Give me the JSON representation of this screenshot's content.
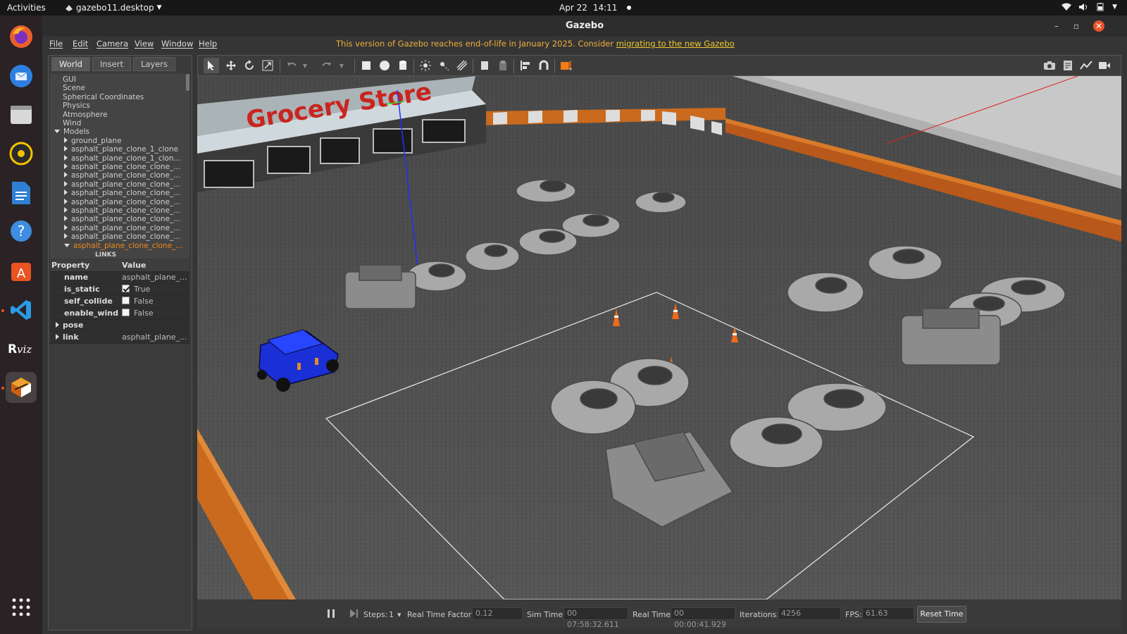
{
  "topbar": {
    "activities": "Activities",
    "app_name": "gazebo11.desktop",
    "date": "Apr 22",
    "time": "14:11"
  },
  "window": {
    "title": "Gazebo",
    "menu": [
      "File",
      "Edit",
      "Camera",
      "View",
      "Window",
      "Help"
    ],
    "eol_text": "This version of Gazebo reaches end-of-life in January 2025. Consider ",
    "eol_link": "migrating to the new Gazebo"
  },
  "left_panel": {
    "tabs": [
      "World",
      "Insert",
      "Layers"
    ],
    "tree": [
      {
        "label": "GUI",
        "indent": 0,
        "arrow": "none"
      },
      {
        "label": "Scene",
        "indent": 0,
        "arrow": "none"
      },
      {
        "label": "Spherical Coordinates",
        "indent": 0,
        "arrow": "none"
      },
      {
        "label": "Physics",
        "indent": 0,
        "arrow": "none"
      },
      {
        "label": "Atmosphere",
        "indent": 0,
        "arrow": "none"
      },
      {
        "label": "Wind",
        "indent": 0,
        "arrow": "none"
      },
      {
        "label": "Models",
        "indent": 0,
        "arrow": "down"
      },
      {
        "label": "ground_plane",
        "indent": 1,
        "arrow": "right"
      },
      {
        "label": "asphalt_plane_clone_1_clone",
        "indent": 1,
        "arrow": "right"
      },
      {
        "label": "asphalt_plane_clone_1_clon...",
        "indent": 1,
        "arrow": "right"
      },
      {
        "label": "asphalt_plane_clone_clone_...",
        "indent": 1,
        "arrow": "right"
      },
      {
        "label": "asphalt_plane_clone_clone_...",
        "indent": 1,
        "arrow": "right"
      },
      {
        "label": "asphalt_plane_clone_clone_...",
        "indent": 1,
        "arrow": "right"
      },
      {
        "label": "asphalt_plane_clone_clone_...",
        "indent": 1,
        "arrow": "right"
      },
      {
        "label": "asphalt_plane_clone_clone_...",
        "indent": 1,
        "arrow": "right"
      },
      {
        "label": "asphalt_plane_clone_clone_...",
        "indent": 1,
        "arrow": "right"
      },
      {
        "label": "asphalt_plane_clone_clone_...",
        "indent": 1,
        "arrow": "right"
      },
      {
        "label": "asphalt_plane_clone_clone_...",
        "indent": 1,
        "arrow": "right"
      },
      {
        "label": "asphalt_plane_clone_clone_...",
        "indent": 1,
        "arrow": "right"
      },
      {
        "label": "asphalt_plane_clone_clone_...",
        "indent": 1,
        "arrow": "down",
        "selected": true
      },
      {
        "label": "LINKS",
        "indent": 2,
        "arrow": "none"
      }
    ],
    "properties": {
      "header": {
        "property": "Property",
        "value": "Value"
      },
      "name": {
        "key": "name",
        "value": "asphalt_plane_..."
      },
      "is_static": {
        "key": "is_static",
        "value": "True"
      },
      "self_collide": {
        "key": "self_collide",
        "value": "False"
      },
      "enable_wind": {
        "key": "enable_wind",
        "value": "False"
      },
      "pose": {
        "key": "pose",
        "value": ""
      },
      "link": {
        "key": "link",
        "value": "asphalt_plane_..."
      }
    }
  },
  "viewport": {
    "sign": "Grocery Store"
  },
  "bottombar": {
    "steps_label": "Steps:",
    "steps_value": "1",
    "rtf_label": "Real Time Factor:",
    "rtf_value": "0.12",
    "sim_time_label": "Sim Time:",
    "sim_time_value": "00 07:58:32.611",
    "real_time_label": "Real Time:",
    "real_time_value": "00 00:00:41.929",
    "iterations_label": "Iterations:",
    "iterations_value": "4256",
    "fps_label": "FPS:",
    "fps_value": "61.63",
    "reset_label": "Reset Time"
  },
  "colors": {
    "accent_orange": "#e95420",
    "selected_tree": "#f08a1c",
    "eol_warning": "#f0b03a",
    "car_blue": "#1a2fd6"
  }
}
